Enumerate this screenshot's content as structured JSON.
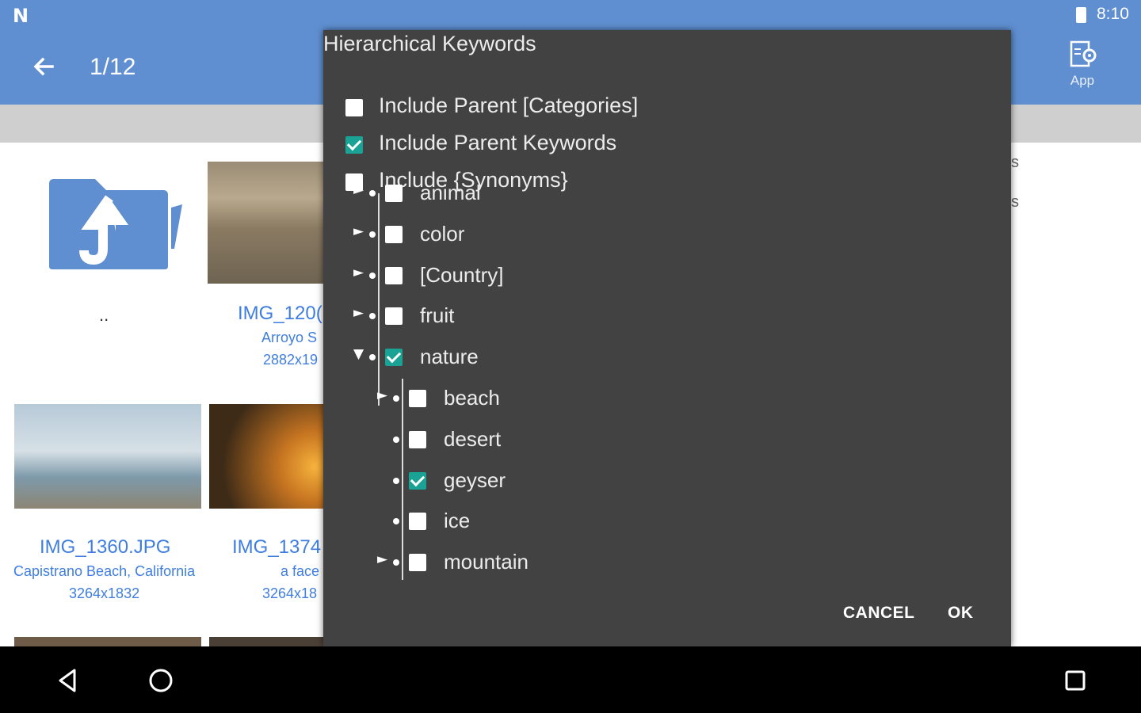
{
  "status": {
    "time": "8:10"
  },
  "appbar": {
    "counter": "1/12",
    "app_label": "App"
  },
  "grid": {
    "up_label": "..",
    "items": [
      {
        "name": "IMG_120(",
        "caption": "Arroyo S",
        "size": "2882x19"
      },
      {
        "name": "IMG_1360.JPG",
        "caption": "Capistrano Beach, California",
        "size": "3264x1832"
      },
      {
        "name": "IMG_1374",
        "caption": "a face",
        "size": "3264x18"
      }
    ],
    "edge_letters": [
      "s",
      "s"
    ]
  },
  "dialog": {
    "title": "Hierarchical Keywords",
    "options": [
      {
        "label": "Include Parent [Categories]",
        "checked": false
      },
      {
        "label": "Include Parent Keywords",
        "checked": true
      },
      {
        "label": "Include {Synonyms}",
        "checked": false
      }
    ],
    "tree": [
      {
        "label": "animal",
        "arrow": "►",
        "checked": false
      },
      {
        "label": "color",
        "arrow": "►",
        "checked": false
      },
      {
        "label": "[Country]",
        "arrow": "►",
        "checked": false
      },
      {
        "label": "fruit",
        "arrow": "►",
        "checked": false
      },
      {
        "label": "nature",
        "arrow": "▼",
        "checked": true
      },
      {
        "label": "beach",
        "arrow": "►",
        "checked": false
      },
      {
        "label": "desert",
        "arrow": "",
        "checked": false
      },
      {
        "label": "geyser",
        "arrow": "",
        "checked": true
      },
      {
        "label": "ice",
        "arrow": "",
        "checked": false
      },
      {
        "label": "mountain",
        "arrow": "►",
        "checked": false
      }
    ],
    "cancel_label": "CANCEL",
    "ok_label": "OK"
  },
  "icons": {
    "back": "arrow-left-icon",
    "app": "app-settings-icon",
    "folder": "folder-up-icon",
    "nav_back": "triangle-back-icon",
    "nav_home": "circle-home-icon",
    "nav_recents": "square-recents-icon"
  },
  "colors": {
    "appbar": "#5f8fd1",
    "dialog": "#424242",
    "accent": "#1aa394",
    "link": "#3f7ee0"
  }
}
